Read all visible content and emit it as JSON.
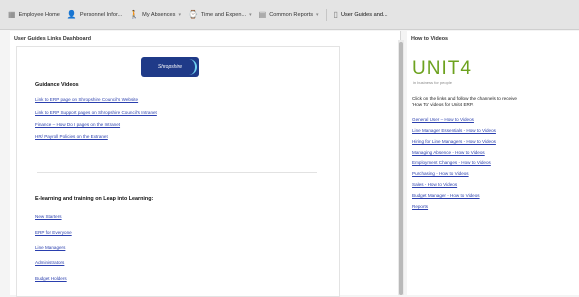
{
  "tabs": [
    {
      "label": "Employee Home",
      "icon": "grid-icon",
      "dropdown": false
    },
    {
      "label": "Personnel Infor...",
      "icon": "person-icon",
      "dropdown": false
    },
    {
      "label": "My Absences",
      "icon": "person-walk-icon",
      "dropdown": true
    },
    {
      "label": "Time and Expen...",
      "icon": "clock-person-icon",
      "dropdown": true
    },
    {
      "label": "Common Reports",
      "icon": "report-icon",
      "dropdown": true
    },
    {
      "label": "User Guides and...",
      "icon": "document-icon",
      "dropdown": false
    }
  ],
  "left": {
    "title": "User Guides Links Dashboard",
    "logo_text": "Shropshire",
    "guidance_heading": "Guidance Videos",
    "guidance_links": [
      "Link to ERP page on Shropshire Council's Website",
      "Link to ERP Support pages on Shropshire Council's Intranet",
      "Finance – How Do I pages on the Intranet",
      "HR/ Payroll Policies on the Extranet"
    ],
    "elearning_heading": "E-learning and training on Leap into Learning:",
    "elearning_links": [
      "New Starters",
      "ERP for Everyone",
      "Line Managers",
      "Administrators",
      "Budget Holders"
    ]
  },
  "right": {
    "title": "How to Videos",
    "brand": "UNIT4",
    "tagline": "in business for people",
    "intro_line1": "Click on the links and follow the channels to receive",
    "intro_line2": "'How To' videos for Unit4 ERP.",
    "links": [
      "General User – How to Videos",
      "Line Manager Essentials - How to Videos",
      "Hiring for Line Managers - How to Videos",
      "Managing Absence - How to Videos",
      "Employment Changes - How to Videos",
      "Purchasing - How to Videos",
      "Sales - How to Videos",
      "Budget Manager - How to Videos",
      "Reports"
    ]
  },
  "colors": {
    "link": "#2a3fae",
    "brand_green": "#6da21f",
    "logo_blue": "#1f3a88"
  }
}
